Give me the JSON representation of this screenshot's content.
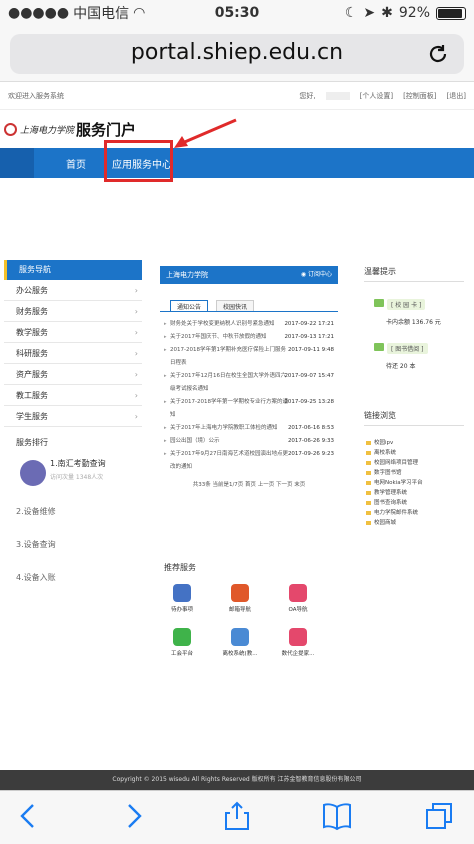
{
  "status": {
    "carrier": "中国电信",
    "time": "05:30",
    "battery": "92%"
  },
  "browser": {
    "url": "portal.shiep.edu.cn"
  },
  "topbar": {
    "welcome": "欢迎进入服务系统",
    "greeting": "您好,",
    "links": [
      "[个人设置]",
      "[控制面板]",
      "[退出]"
    ]
  },
  "logo": {
    "school": "上海电力学院",
    "title": "服务门户"
  },
  "nav": {
    "home": "首页",
    "app_center": "应用服务中心"
  },
  "sidebar": {
    "title": "服务导航",
    "items": [
      {
        "label": "办公服务"
      },
      {
        "label": "财务服务"
      },
      {
        "label": "教学服务"
      },
      {
        "label": "科研服务"
      },
      {
        "label": "资产服务"
      },
      {
        "label": "教工服务"
      },
      {
        "label": "学生服务"
      }
    ],
    "rank_title": "服务排行",
    "rank_1": "1.南汇考勤查询",
    "rank_1_sub": "访问次量 1348人次",
    "rank_2": "2.设备维修",
    "rank_3": "3.设备查询",
    "rank_4": "4.设备入账"
  },
  "center": {
    "title": "上海电力学院",
    "subscribe": "订阅中心",
    "tabs": [
      "通知公告",
      "校园快讯"
    ],
    "news": [
      {
        "title": "财务处关于学校变更纳税人识别号紧急通知",
        "date": "2017-09-22 17:21",
        "two": false
      },
      {
        "title": "关于2017年国庆节、中秋节放假的通知",
        "date": "2017-09-13 17:21",
        "two": false
      },
      {
        "title": "2017-2018学年第1学期补充医疗保险上门服务日程表",
        "date": "2017-09-11 9:48",
        "two": true
      },
      {
        "title": "关于2017年12月16日在校生全国大学外语四六级考试报名通知",
        "date": "2017-09-07 15:47",
        "two": true
      },
      {
        "title": "关于2017-2018学年第一学期校专业行方案的通知",
        "date": "2017-09-25 13:28",
        "two": true
      },
      {
        "title": "关于2017年上海电力学院教职工体检的通知",
        "date": "2017-06-16 8:53",
        "two": false
      },
      {
        "title": "园公出国（境）公示",
        "date": "2017-06-26 9:33",
        "two": false
      },
      {
        "title": "关于2017年9月27日南海艺术道校园演出地点更改的通知",
        "date": "2017-09-26 9:23",
        "two": true
      }
    ],
    "pager": "共33条  当前是1/7页  首页  上一页  下一页  末页",
    "rec_title": "推荐服务",
    "apps": [
      {
        "name": "待办事项",
        "color": "#4472c4"
      },
      {
        "name": "邮箱导航",
        "color": "#e0582a"
      },
      {
        "name": "OA导航",
        "color": "#e4486c"
      },
      {
        "name": "工会平台",
        "color": "#3fb34a"
      },
      {
        "name": "离校系统(教...",
        "color": "#4a8ad4"
      },
      {
        "name": "数代企提家...",
        "color": "#e4486c"
      }
    ]
  },
  "right": {
    "tip_title": "温馨提示",
    "card1_label": "[ 校 园 卡 ]",
    "card1_val": "卡内余额 136.76 元",
    "card2_label": "[ 图书借阅 ]",
    "card2_val": "待还 20 本",
    "links_title": "链接浏览",
    "links": [
      "校园ipv",
      "离校系统",
      "校园网络项目管理",
      "数字图书馆",
      "电网Nokia学习平台",
      "教学管理系统",
      "图书查询系统",
      "电力学院邮件系统",
      "校园商城"
    ]
  },
  "footer": "Copyright © 2015 wisedu All Rights Reserved 版权所有 江苏金智教育信息股份有限公司"
}
